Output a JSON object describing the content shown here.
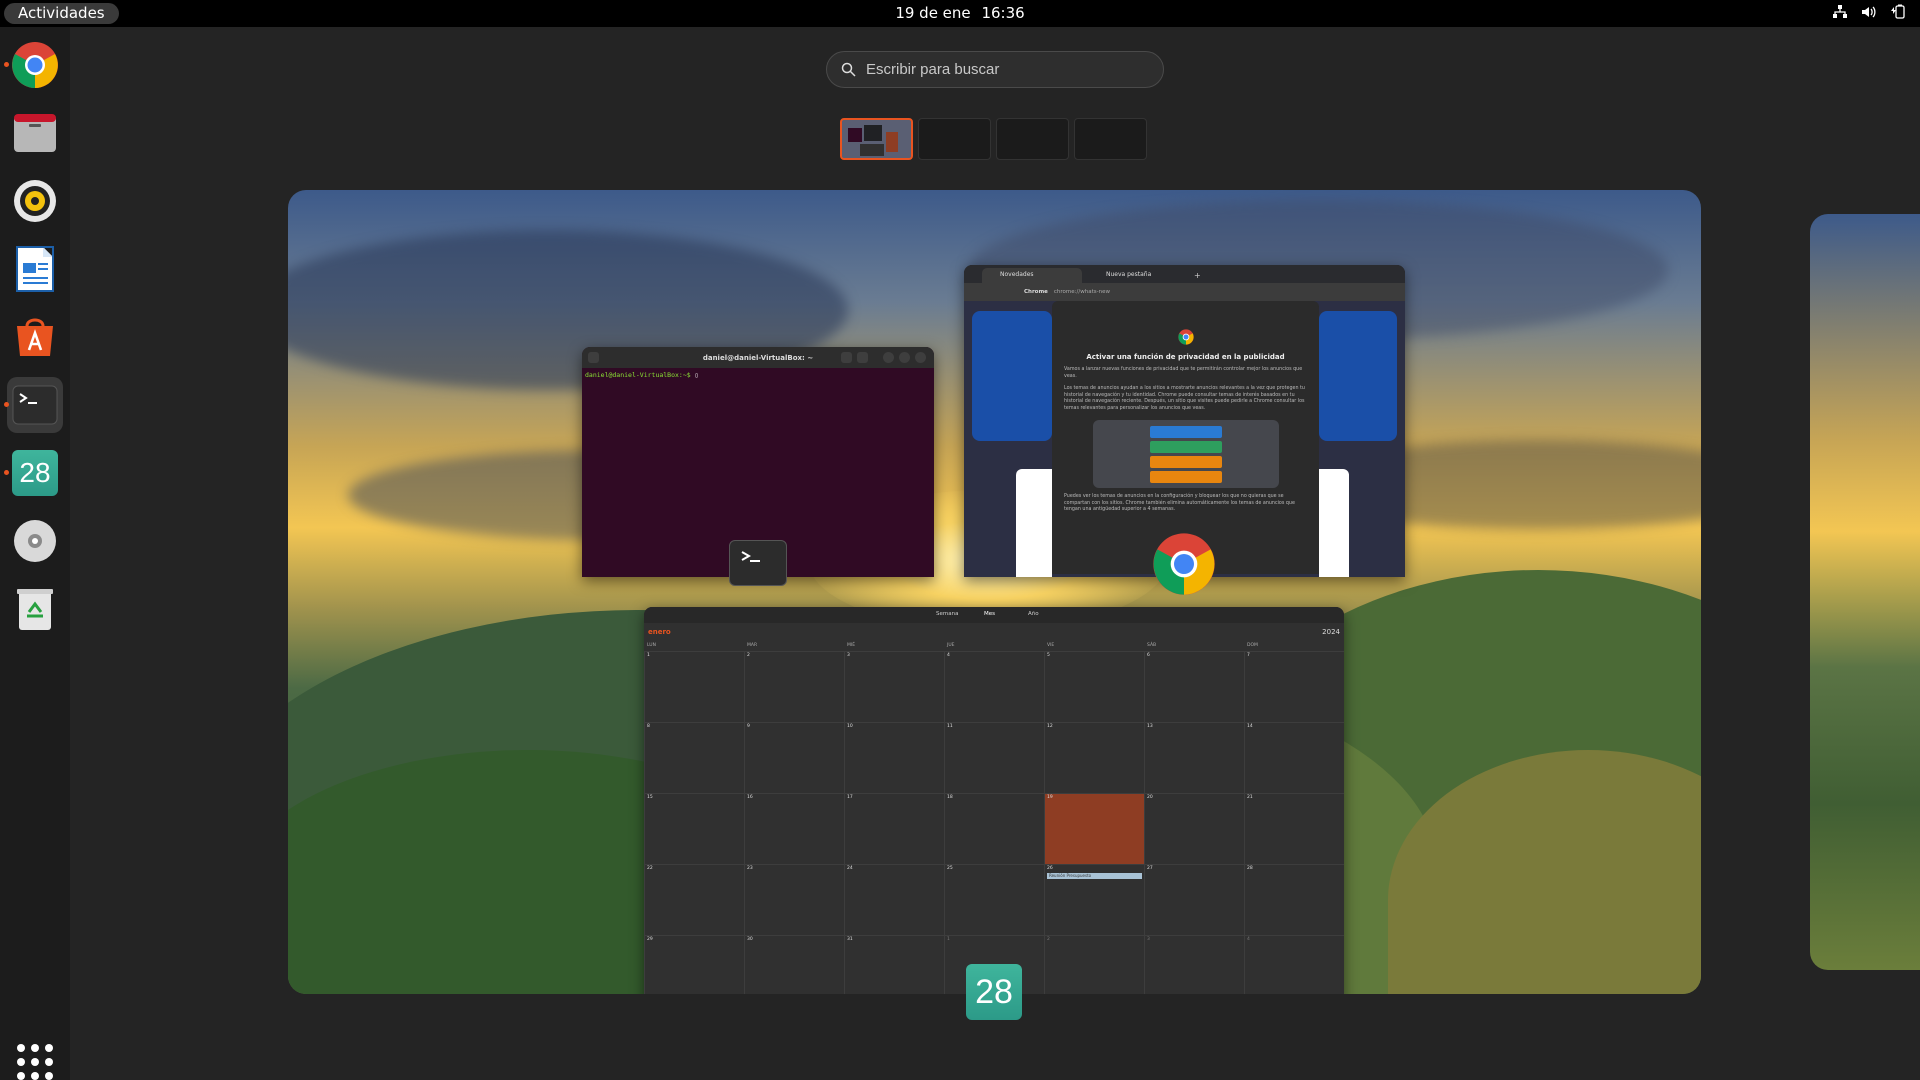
{
  "topbar": {
    "activities": "Actividades",
    "date": "19 de ene",
    "time": "16:36"
  },
  "dock": {
    "items": [
      {
        "name": "Google Chrome",
        "icon": "chrome-icon",
        "running": true
      },
      {
        "name": "Archivos",
        "icon": "files-icon",
        "running": false
      },
      {
        "name": "Rhythmbox",
        "icon": "rhythmbox-icon",
        "running": false
      },
      {
        "name": "LibreOffice Writer",
        "icon": "writer-icon",
        "running": false
      },
      {
        "name": "Ubuntu Software",
        "icon": "software-icon",
        "running": false
      },
      {
        "name": "Terminal",
        "icon": "terminal-icon",
        "running": true
      },
      {
        "name": "Calendario",
        "icon": "calendar-icon",
        "running": true,
        "label": "28"
      },
      {
        "name": "Disco",
        "icon": "disc-icon",
        "running": false
      },
      {
        "name": "Papelera",
        "icon": "trash-icon",
        "running": false
      }
    ],
    "show_apps_icon": "apps-grid-icon"
  },
  "search": {
    "placeholder": "Escribir para buscar"
  },
  "workspaces": {
    "count": 4,
    "current": 1
  },
  "windows": {
    "terminal": {
      "title": "daniel@daniel-VirtualBox: ~",
      "prompt": "daniel@daniel-VirtualBox:~$ "
    },
    "chrome": {
      "tabs": [
        "Novedades",
        "Nueva pestaña"
      ],
      "url_label": "Chrome",
      "url": "chrome://whats-new",
      "dialog_title": "Activar una función de privacidad en la publicidad",
      "dialog_text_1": "Vamos a lanzar nuevas funciones de privacidad que te permitirán controlar mejor los anuncios que veas.",
      "dialog_text_2": "Los temas de anuncios ayudan a los sitios a mostrarte anuncios relevantes a la vez que protegen tu historial de navegación y tu identidad. Chrome puede consultar temas de interés basados en tu historial de navegación reciente. Después, un sitio que visites puede pedirle a Chrome consultar los temas relevantes para personalizar los anuncios que veas.",
      "dialog_text_3": "Puedes ver los temas de anuncios en la configuración y bloquear los que no quieras que se compartan con los sitios. Chrome también elimina automáticamente los temas de anuncios que tengan una antigüedad superior a 4 semanas."
    },
    "calendar": {
      "views": [
        "Semana",
        "Mes",
        "Año"
      ],
      "month": "enero",
      "year": "2024",
      "weekdays": [
        "LUN",
        "MAR",
        "MIÉ",
        "JUE",
        "VIE",
        "SÁB",
        "DOM"
      ],
      "days": [
        [
          "1",
          "2",
          "3",
          "4",
          "5",
          "6",
          "7"
        ],
        [
          "8",
          "9",
          "10",
          "11",
          "12",
          "13",
          "14"
        ],
        [
          "15",
          "16",
          "17",
          "18",
          "19",
          "20",
          "21"
        ],
        [
          "22",
          "23",
          "24",
          "25",
          "26",
          "27",
          "28"
        ],
        [
          "29",
          "30",
          "31",
          "1",
          "2",
          "3",
          "4"
        ]
      ],
      "today": "19",
      "event": "Reunión Presupuesto"
    }
  },
  "colors": {
    "accent": "#e95420",
    "terminal_bg": "#300a24",
    "topbar": "#000000",
    "dock": "#1c1c1c"
  }
}
